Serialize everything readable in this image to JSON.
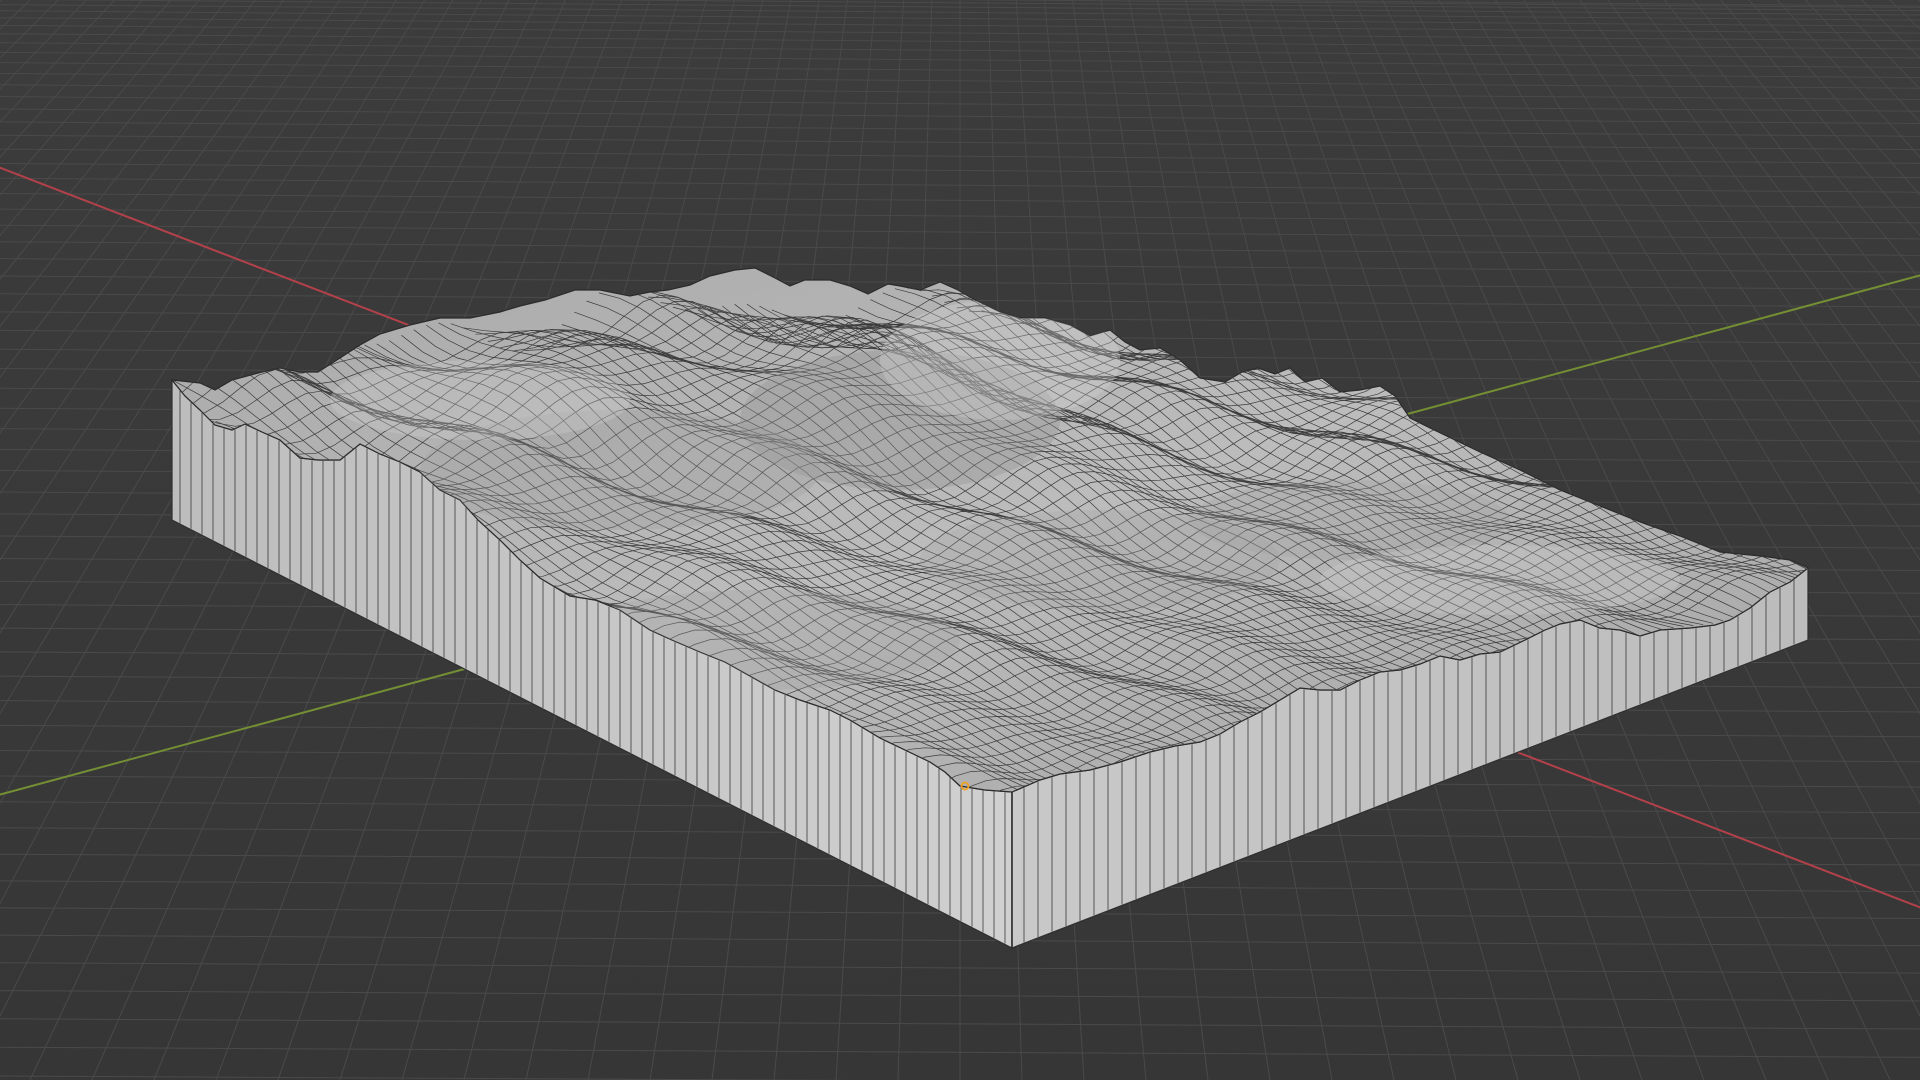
{
  "viewport": {
    "background_color": "#3a3a3a",
    "grid_color": "#4b4b4b",
    "x_axis_color": "#c64a52",
    "y_axis_color": "#7d9a38",
    "origin_marker_color": "#f0a020"
  },
  "object": {
    "type": "terrain-mesh",
    "surface_color": "#b9b9b9",
    "side_color": "#c4c4c4",
    "wire_color": "#2e2e2e",
    "selected": false
  }
}
